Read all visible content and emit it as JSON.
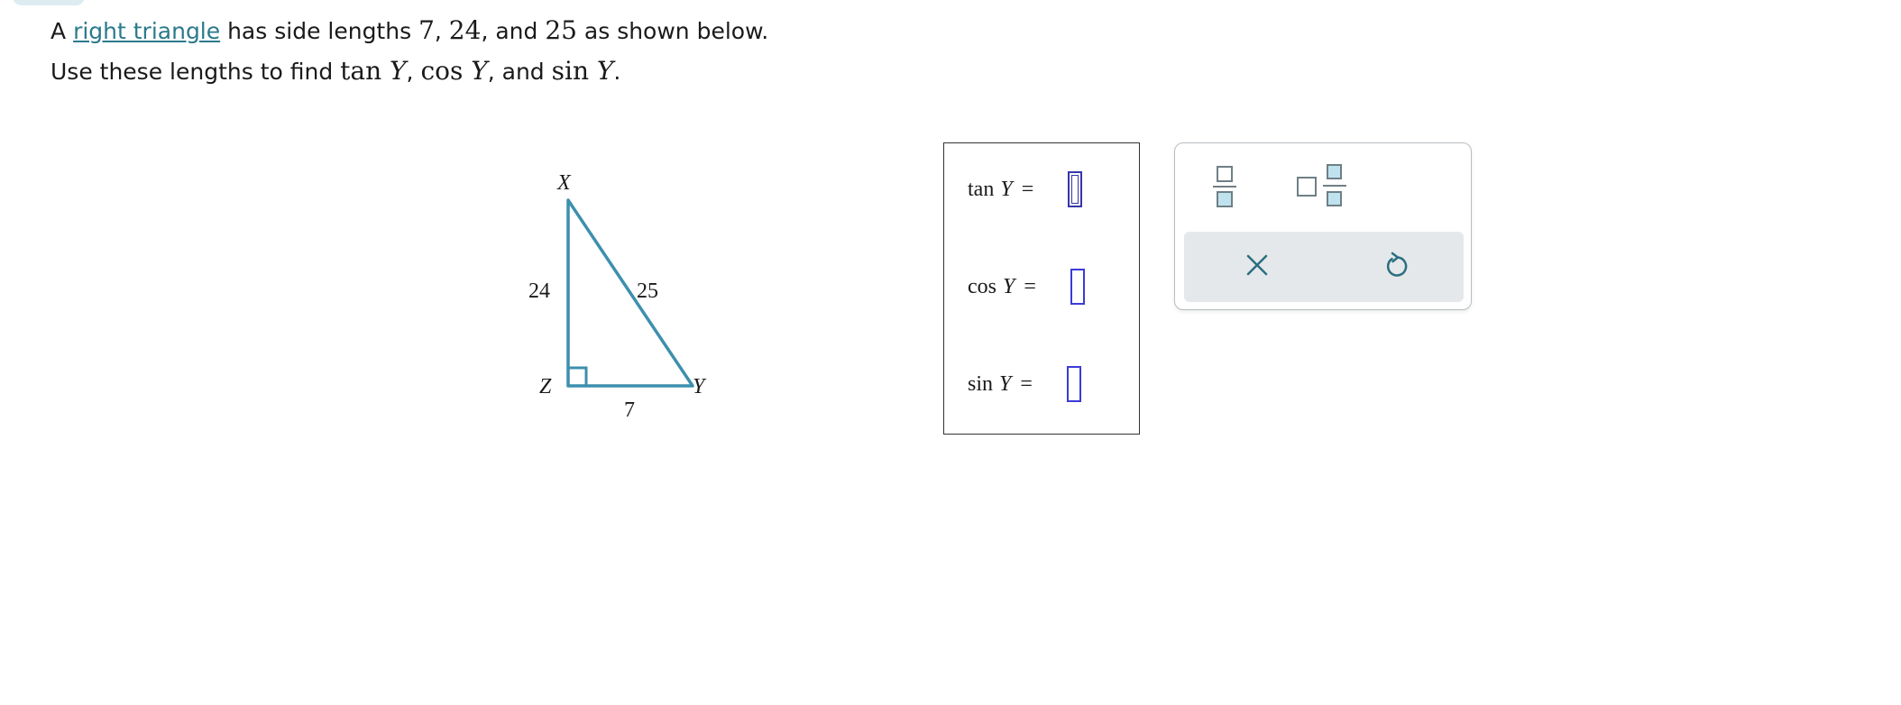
{
  "prompt": {
    "line1": {
      "prefix": "A ",
      "link": "right triangle",
      "mid1": " has side lengths ",
      "n1": "7",
      "c1": ", ",
      "n2": "24",
      "mid2": ", and ",
      "n3": "25",
      "suffix": " as shown below."
    },
    "line2": {
      "prefix": "Use these lengths to find ",
      "tan_fn": "tan",
      "var1": "Y",
      "sep1": ", ",
      "cos_fn": "cos",
      "var2": "Y",
      "sep2": ", and ",
      "sin_fn": "sin",
      "var3": "Y",
      "end": "."
    }
  },
  "triangle": {
    "vertices": {
      "top": "X",
      "right_angle": "Z",
      "right": "Y"
    },
    "sides": {
      "vertical": "24",
      "hypotenuse": "25",
      "horizontal": "7"
    },
    "stroke_color": "#3d8fae"
  },
  "answers": [
    {
      "fn": "tan",
      "var": "Y",
      "eq": "=",
      "value": ""
    },
    {
      "fn": "cos",
      "var": "Y",
      "eq": "=",
      "value": ""
    },
    {
      "fn": "sin",
      "var": "Y",
      "eq": "=",
      "value": ""
    }
  ],
  "toolbox": {
    "icons": [
      "fraction-icon",
      "mixed-number-icon",
      "clear-icon",
      "undo-icon"
    ],
    "accent_color": "#6aa8b9",
    "bar_color": "#e4e8ea"
  }
}
